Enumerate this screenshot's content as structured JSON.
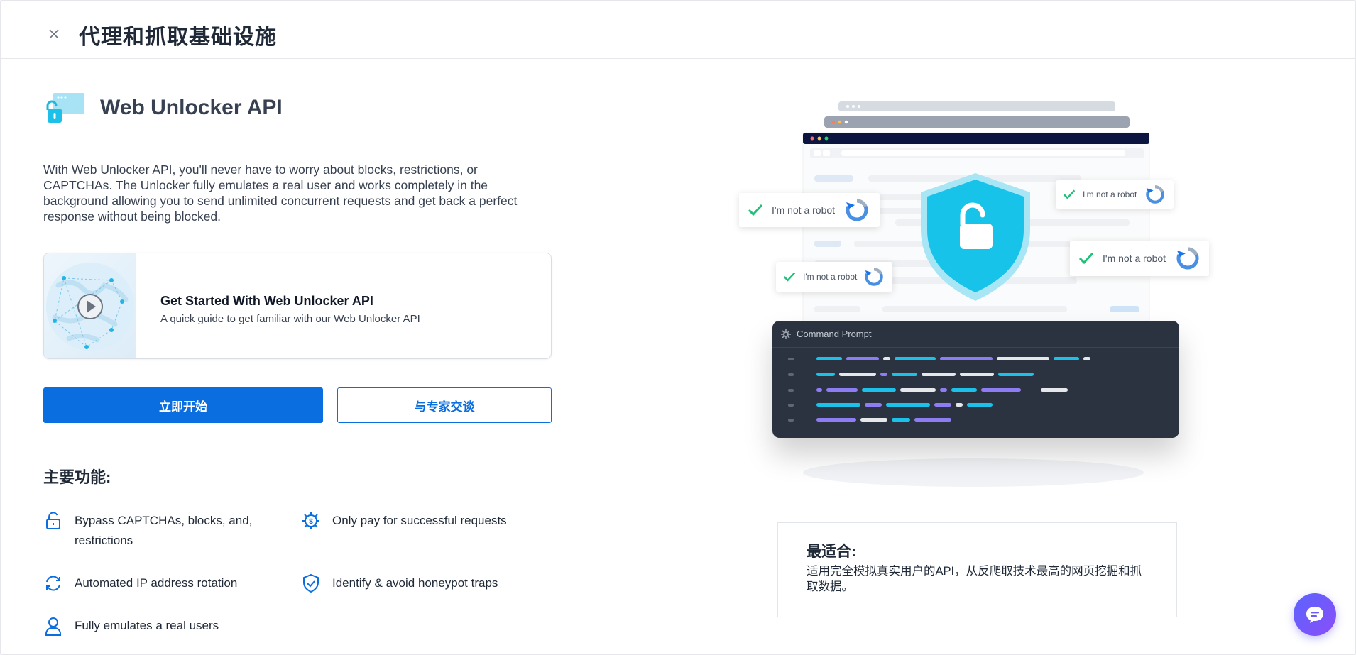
{
  "header": {
    "title": "代理和抓取基础设施",
    "close_icon": "close-icon"
  },
  "product": {
    "name": "Web Unlocker API",
    "logo_icon": "unlocked-browser-icon",
    "description": "With Web Unlocker API, you'll never have to worry about blocks, restrictions, or CAPTCHAs. The Unlocker fully emulates a real user and works completely in the background allowing you to send unlimited concurrent requests and get back a perfect response without being blocked."
  },
  "guide": {
    "title": "Get Started With Web Unlocker API",
    "subtitle": "A quick guide to get familiar with our Web Unlocker API",
    "icon": "play-icon"
  },
  "actions": {
    "primary_label": "立即开始",
    "secondary_label": "与专家交谈"
  },
  "features": {
    "title": "主要功能:",
    "items": [
      {
        "label": "Bypass CAPTCHAs, blocks, and, restrictions",
        "icon": "unlock-icon"
      },
      {
        "label": "Only pay for successful requests",
        "icon": "dollar-gear-icon"
      },
      {
        "label": "Automated IP address rotation",
        "icon": "rotate-icon"
      },
      {
        "label": "Identify & avoid honeypot traps",
        "icon": "shield-check-icon"
      },
      {
        "label": "Fully emulates a real users",
        "icon": "user-icon"
      }
    ]
  },
  "illustration": {
    "captcha_label": "I'm not a robot",
    "command_title": "Command Prompt",
    "shield_icon": "shield-unlock-icon"
  },
  "best_for": {
    "title": "最适合:",
    "text": "适用完全模拟真实用户的API，从反爬取技术最高的网页挖掘和抓取数据。"
  },
  "chat": {
    "icon": "chat-icon"
  },
  "colors": {
    "primary": "#0b6ee0",
    "accent_cyan": "#1cc0e8",
    "terminal_bg": "#2b3340",
    "chat_gradient_start": "#5b63ff",
    "chat_gradient_end": "#8a4ff7"
  }
}
